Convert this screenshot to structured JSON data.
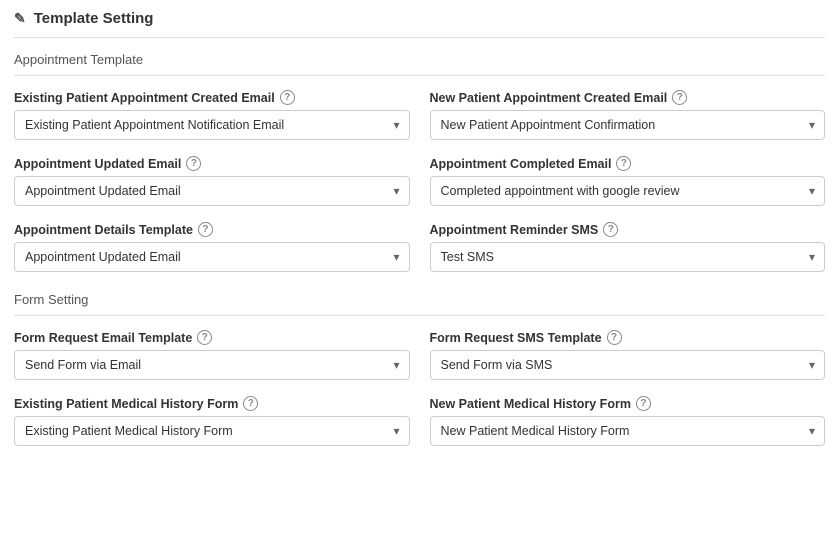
{
  "page": {
    "title": "Template Setting",
    "edit_icon": "✎"
  },
  "appointment_section": {
    "title": "Appointment Template",
    "fields": [
      {
        "id": "existing-patient-appt-created",
        "label": "Existing Patient Appointment Created Email",
        "selected": "Existing Patient Appointment Notification Email",
        "options": [
          "Existing Patient Appointment Notification Email"
        ]
      },
      {
        "id": "new-patient-appt-created",
        "label": "New Patient Appointment Created Email",
        "selected": "New Patient Appointment Confirmation",
        "options": [
          "New Patient Appointment Confirmation"
        ]
      },
      {
        "id": "appointment-updated-email",
        "label": "Appointment Updated Email",
        "selected": "Appointment Updated Email",
        "options": [
          "Appointment Updated Email"
        ]
      },
      {
        "id": "appointment-completed-email",
        "label": "Appointment Completed Email",
        "selected": "Completed appointment with google review",
        "options": [
          "Completed appointment with google review"
        ]
      },
      {
        "id": "appointment-details-template",
        "label": "Appointment Details Template",
        "selected": "Appointment Updated Email",
        "options": [
          "Appointment Updated Email"
        ]
      },
      {
        "id": "appointment-reminder-sms",
        "label": "Appointment Reminder SMS",
        "selected": "Test SMS",
        "options": [
          "Test SMS"
        ]
      }
    ]
  },
  "form_section": {
    "title": "Form Setting",
    "fields": [
      {
        "id": "form-request-email-template",
        "label": "Form Request Email Template",
        "selected": "Send Form via Email",
        "options": [
          "Send Form via Email"
        ]
      },
      {
        "id": "form-request-sms-template",
        "label": "Form Request SMS Template",
        "selected": "Send Form via SMS",
        "options": [
          "Send Form via SMS"
        ]
      },
      {
        "id": "existing-patient-medical-history-form",
        "label": "Existing Patient Medical History Form",
        "selected": "Existing Patient Medical History Form",
        "options": [
          "Existing Patient Medical History Form"
        ]
      },
      {
        "id": "new-patient-medical-history-form",
        "label": "New Patient Medical History Form",
        "selected": "New Patient Medical History Form",
        "options": [
          "New Patient Medical History Form"
        ]
      }
    ]
  }
}
